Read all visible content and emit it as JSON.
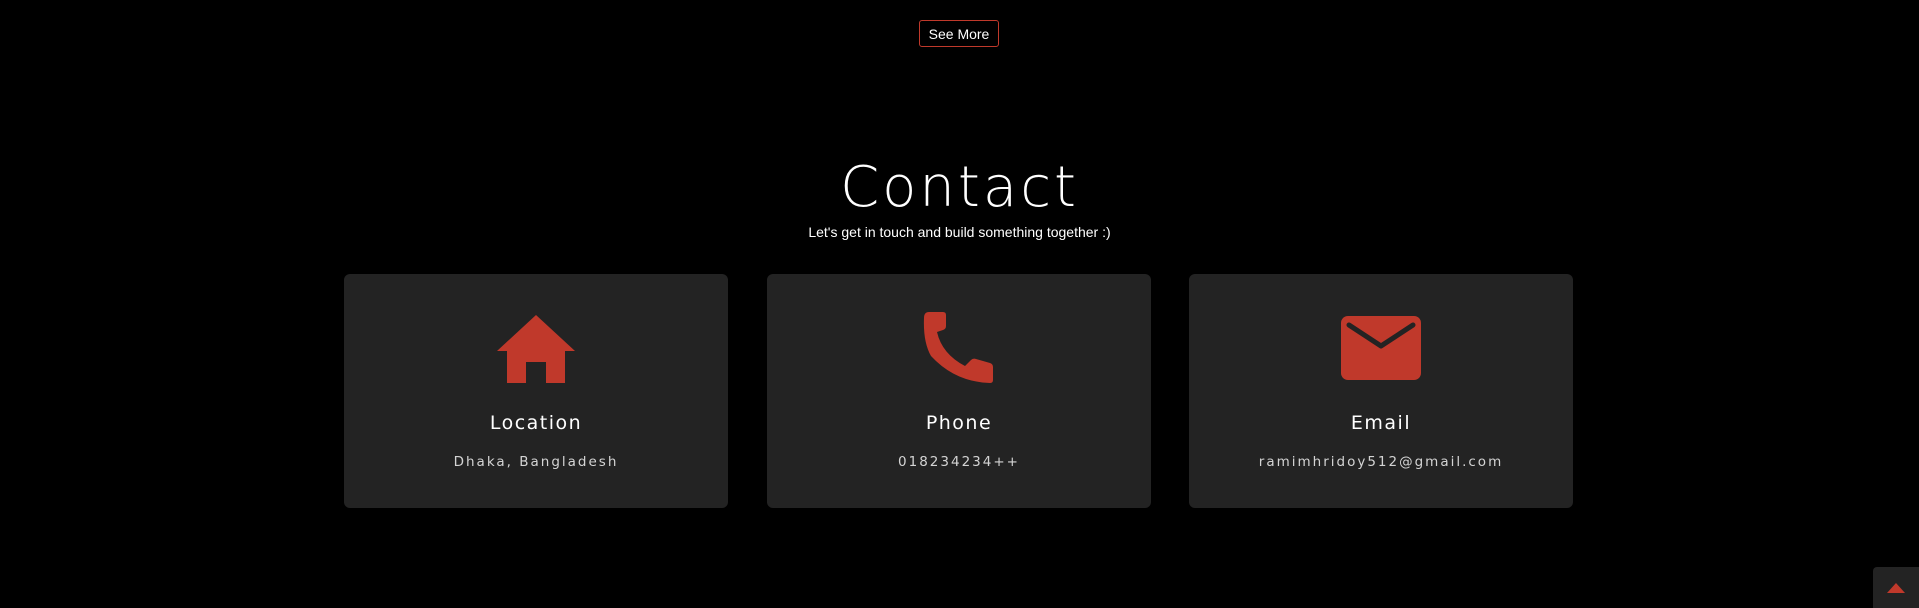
{
  "see_more": {
    "label": "See More"
  },
  "contact": {
    "title": "Contact",
    "subtitle": "Let's get in touch and build something together :)"
  },
  "cards": [
    {
      "icon": "home-icon",
      "title": "Location",
      "value": "Dhaka, Bangladesh"
    },
    {
      "icon": "phone-icon",
      "title": "Phone",
      "value": "018234234++"
    },
    {
      "icon": "envelope-icon",
      "title": "Email",
      "value": "ramimhridoy512@gmail.com"
    }
  ],
  "scroll_top": {
    "icon": "caret-up-icon"
  },
  "colors": {
    "accent": "#c0392b",
    "background": "#000000",
    "card": "#232323"
  }
}
